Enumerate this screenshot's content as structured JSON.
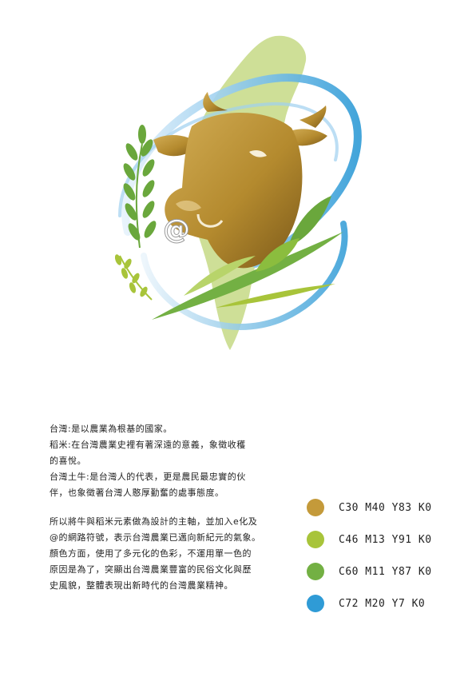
{
  "logo": {
    "mark_text": "@"
  },
  "description": {
    "line1": "台灣:是以農業為根基的國家。",
    "line2": "稻米:在台灣農業史裡有著深遠的意義，象徵收穫",
    "line3": "的喜悅。",
    "line4": "台灣土牛:是台灣人的代表，更是農民最忠實的伙",
    "line5": "伴，也象徵著台灣人憨厚勤奮的處事態度。",
    "line6": "所以將牛與稻米元素做為設計的主軸，並加入e化及",
    "line7": "@的網路符號，表示台灣農業已邁向新紀元的氣象。",
    "line8": "顏色方面，使用了多元化的色彩，不運用單一色的",
    "line9": "原因是為了，突顯出台灣農業豐富的民俗文化與歷",
    "line10": "史風貌，整體表現出新時代的台灣農業精神。"
  },
  "colors": [
    {
      "label": "C30  M40  Y83  K0",
      "hex": "#c49a3a"
    },
    {
      "label": "C46  M13  Y91  K0",
      "hex": "#a8c43a"
    },
    {
      "label": "C60  M11  Y87  K0",
      "hex": "#73b043"
    },
    {
      "label": "C72  M20  Y7  K0",
      "hex": "#2f9bd6"
    }
  ]
}
